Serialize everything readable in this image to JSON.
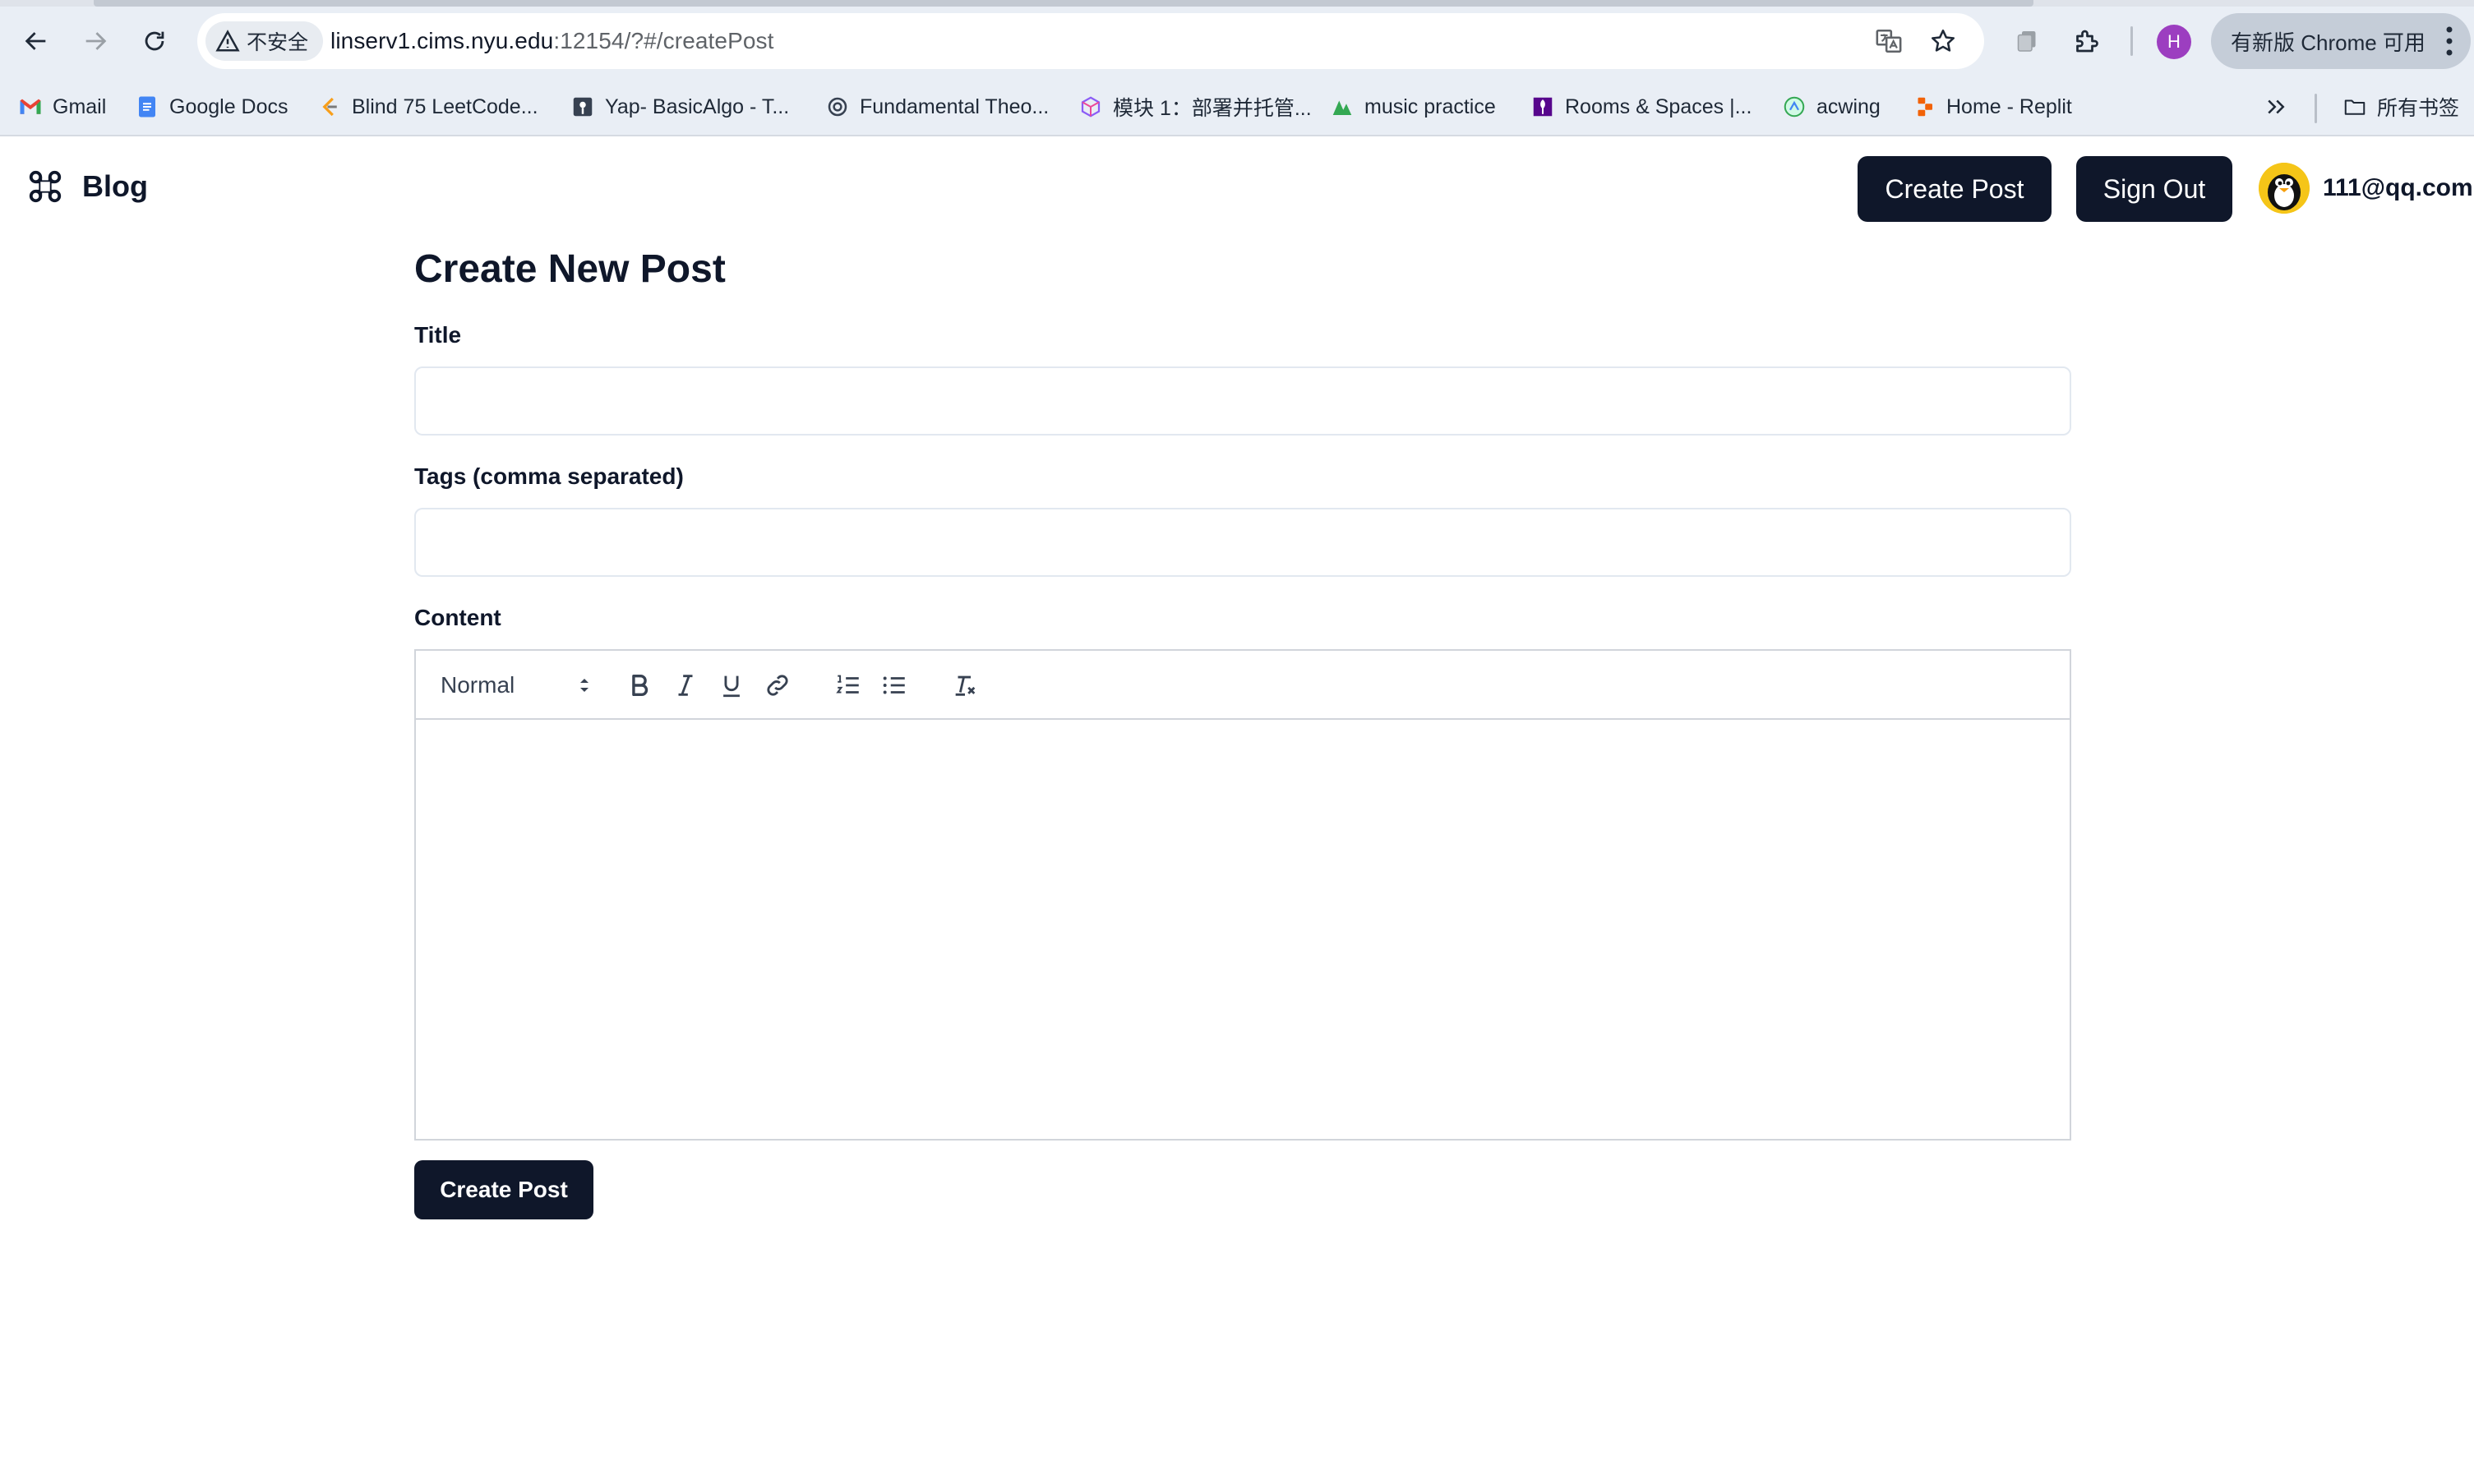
{
  "browser": {
    "security_label": "不安全",
    "url_host": "linserv1.cims.nyu.edu",
    "url_rest": ":12154/?#/createPost",
    "profile_initial": "H",
    "update_label": "有新版 Chrome 可用",
    "bookmarks": [
      {
        "label": "Gmail",
        "icon": "gmail-icon"
      },
      {
        "label": "Google Docs",
        "icon": "google-docs-icon"
      },
      {
        "label": "Blind 75 LeetCode...",
        "icon": "leetcode-icon"
      },
      {
        "label": "Yap- BasicAlgo - T...",
        "icon": "yap-icon"
      },
      {
        "label": "Fundamental Theo...",
        "icon": "openai-icon"
      },
      {
        "label": "模块 1：部署并托管...",
        "icon": "cube-icon"
      },
      {
        "label": "music practice",
        "icon": "music-icon"
      },
      {
        "label": "Rooms & Spaces |...",
        "icon": "nyu-icon"
      },
      {
        "label": "acwing",
        "icon": "acwing-icon"
      },
      {
        "label": "Home - Replit",
        "icon": "replit-icon"
      }
    ],
    "all_bookmarks_label": "所有书签"
  },
  "header": {
    "brand": "Blog",
    "create_post_label": "Create Post",
    "sign_out_label": "Sign Out",
    "user_email": "111@qq.com"
  },
  "form": {
    "title": "Create New Post",
    "title_label": "Title",
    "title_value": "",
    "tags_label": "Tags (comma separated)",
    "tags_value": "",
    "content_label": "Content",
    "editor": {
      "format_value": "Normal",
      "toolbar_icons": [
        "bold-icon",
        "italic-icon",
        "underline-icon",
        "link-icon",
        "ordered-list-icon",
        "bullet-list-icon",
        "clear-format-icon"
      ]
    },
    "submit_label": "Create Post"
  },
  "colors": {
    "primary": "#0f172a",
    "border": "#e2e8f0",
    "chrome_bg": "#e9eef5",
    "profile": "#9c3ec0"
  }
}
